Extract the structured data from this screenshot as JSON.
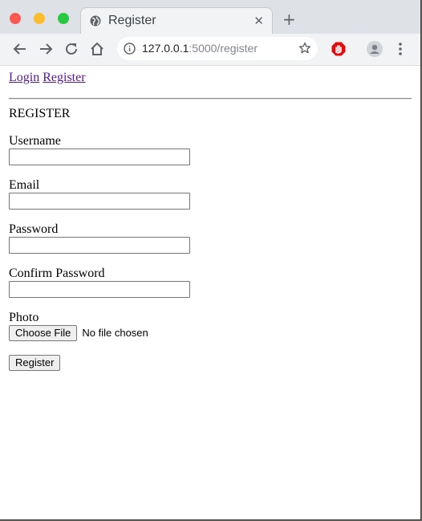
{
  "browser": {
    "tab_title": "Register",
    "url_host": "127.0.0.1",
    "url_path": ":5000/register"
  },
  "nav": {
    "login": "Login",
    "register": "Register"
  },
  "form": {
    "heading": "REGISTER",
    "username_label": "Username",
    "email_label": "Email",
    "password_label": "Password",
    "confirm_label": "Confirm Password",
    "photo_label": "Photo",
    "choose_file": "Choose File",
    "no_file": "No file chosen",
    "submit": "Register"
  }
}
